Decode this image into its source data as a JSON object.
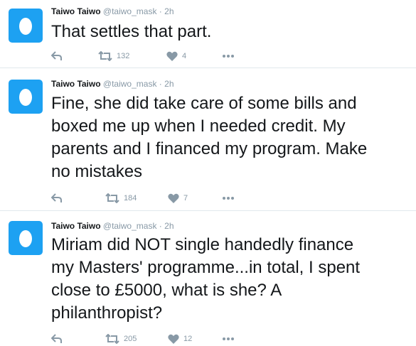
{
  "tweets": [
    {
      "name": "Taiwo Taiwo",
      "handle": "@taiwo_mask",
      "separator": "·",
      "time": "2h",
      "text": "That settles that part.",
      "retweets": "132",
      "likes": "4"
    },
    {
      "name": "Taiwo Taiwo",
      "handle": "@taiwo_mask",
      "separator": "·",
      "time": "2h",
      "text": "Fine, she did take care of some bills and\nboxed me up when I needed credit. My\nparents and I financed my program. Make\nno mistakes",
      "retweets": "184",
      "likes": "7"
    },
    {
      "name": "Taiwo Taiwo",
      "handle": "@taiwo_mask",
      "separator": "·",
      "time": "2h",
      "text": "Miriam did NOT single handedly finance\nmy Masters' programme...in total, I spent\nclose to £5000, what is she? A\nphilanthropist?",
      "retweets": "205",
      "likes": "12"
    }
  ],
  "icons": {
    "avatar": "egg-avatar-icon",
    "reply": "reply-icon",
    "retweet": "retweet-icon",
    "like": "heart-icon",
    "more": "more-dots-icon"
  },
  "colors": {
    "avatar_bg": "#1da1f2",
    "icon_gray": "#8899a6",
    "divider": "#e1e8ed"
  }
}
